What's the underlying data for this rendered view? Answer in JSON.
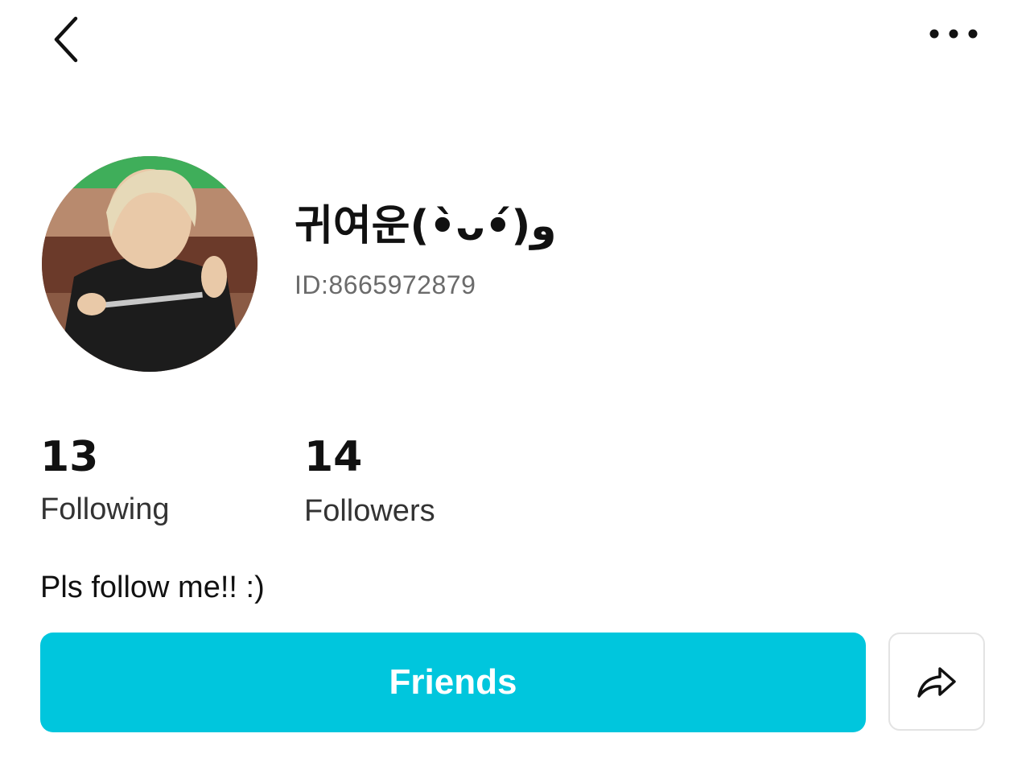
{
  "header": {
    "back_icon": "chevron-left-icon",
    "more_icon": "more-horizontal-icon"
  },
  "profile": {
    "avatar_icon": "profile-photo",
    "display_name": "귀여운(•̀ᴗ•́)و",
    "user_id": "ID:8665972879",
    "bio": "Pls follow me!! :)"
  },
  "stats": {
    "following_count": "13",
    "following_label": "Following",
    "followers_count": "14",
    "followers_label": "Followers"
  },
  "actions": {
    "friends_label": "Friends",
    "share_icon": "share-arrow-icon"
  },
  "colors": {
    "accent": "#00C6DD",
    "text_primary": "#111111",
    "text_secondary": "#6B6B6B",
    "border": "#E3E3E3"
  }
}
